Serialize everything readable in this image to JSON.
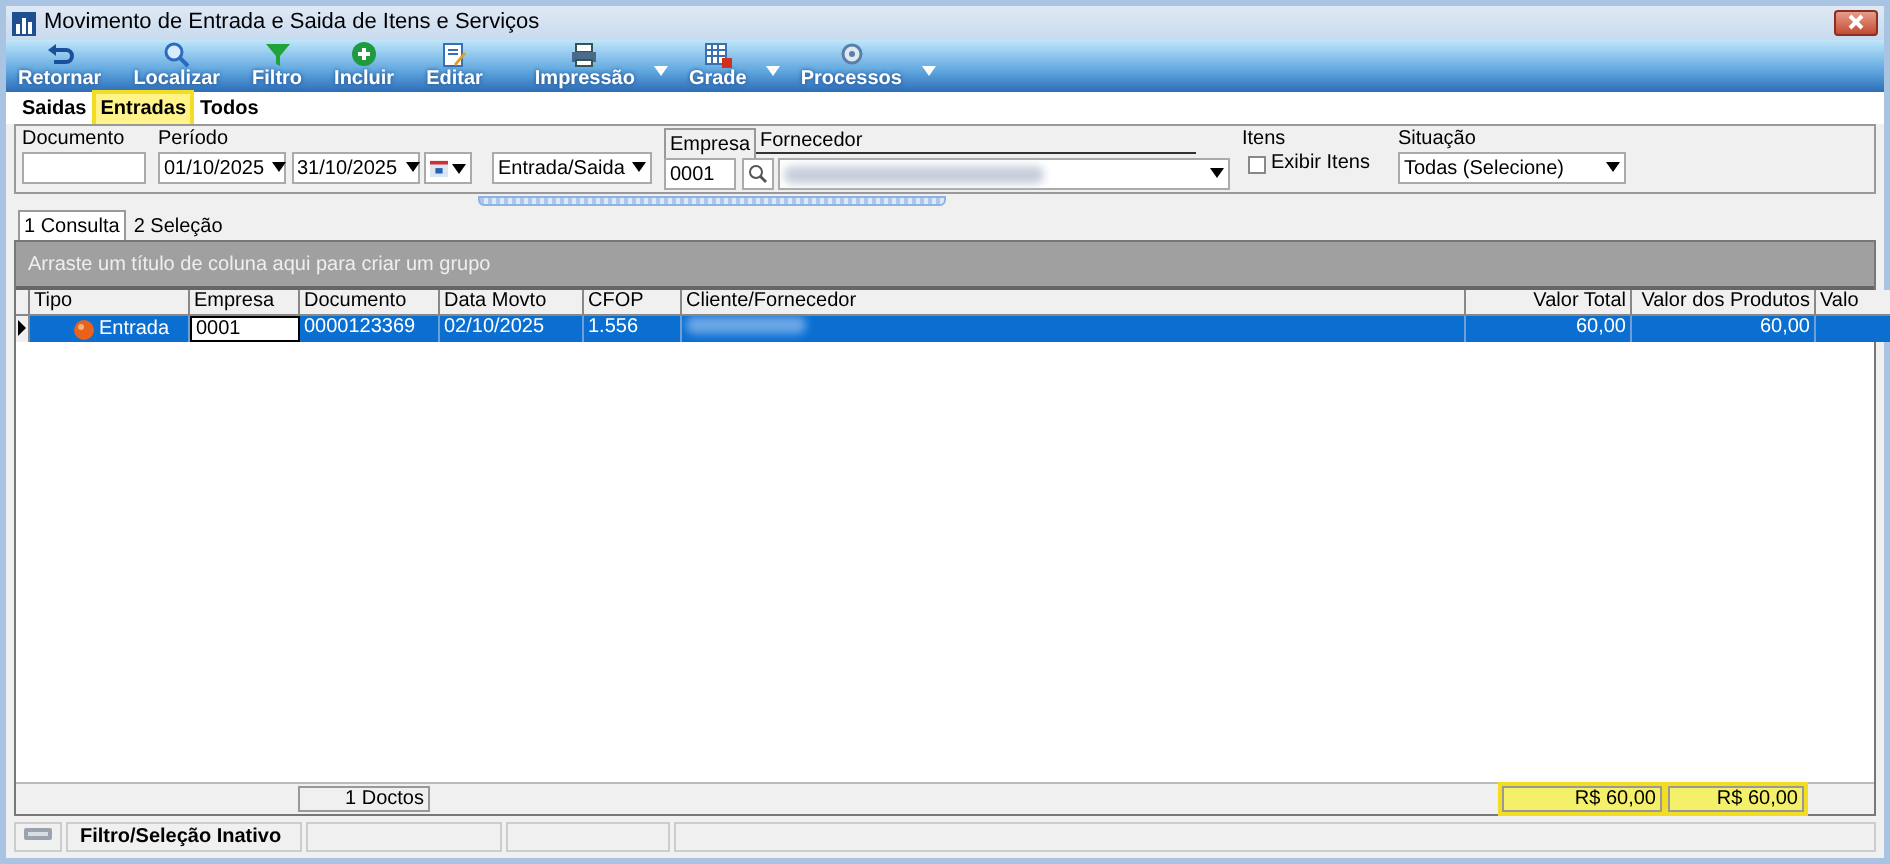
{
  "window": {
    "title": "Movimento de Entrada e Saida de Itens e Serviços"
  },
  "toolbar": [
    {
      "label": "Retornar",
      "dropdown": false
    },
    {
      "label": "Localizar",
      "dropdown": false
    },
    {
      "label": "Filtro",
      "dropdown": false
    },
    {
      "label": "Incluir",
      "dropdown": false
    },
    {
      "label": "Editar",
      "dropdown": false
    },
    {
      "label": "Impressão",
      "dropdown": true
    },
    {
      "label": "Grade",
      "dropdown": true
    },
    {
      "label": "Processos",
      "dropdown": true
    }
  ],
  "filter_tabs": [
    {
      "label": "Saidas",
      "selected": false
    },
    {
      "label": "Entradas",
      "selected": true
    },
    {
      "label": "Todos",
      "selected": false
    }
  ],
  "filters": {
    "documento": {
      "label": "Documento"
    },
    "periodo": {
      "label": "Período",
      "from": "01/10/2025",
      "to": "31/10/2025"
    },
    "tipo": {
      "value": "Entrada/Saida"
    },
    "lookup_tabs": [
      {
        "label": "Empresa",
        "selected": true
      },
      {
        "label": "Fornecedor",
        "selected": false
      }
    ],
    "empresa_code": "0001",
    "itens": {
      "label": "Itens",
      "checkbox": "Exibir Itens",
      "checked": false
    },
    "situacao": {
      "label": "Situação",
      "value": "Todas (Selecione)"
    }
  },
  "view_tabs": [
    {
      "label": "1 Consulta",
      "selected": true
    },
    {
      "label": "2 Seleção",
      "selected": false
    }
  ],
  "group_panel": "Arraste um título de coluna aqui para criar um grupo",
  "table": {
    "columns": [
      "Tipo",
      "Empresa",
      "Documento",
      "Data Movto",
      "CFOP",
      "Cliente/Fornecedor",
      "Valor Total",
      "Valor dos Produtos",
      "Valo"
    ],
    "rows": [
      {
        "tipo": "Entrada",
        "empresa": "0001",
        "documento": "0000123369",
        "data": "02/10/2025",
        "cfop": "1.556",
        "valor_total": "60,00",
        "valor_produtos": "60,00",
        "selected": true
      }
    ]
  },
  "footer": {
    "count": "1 Doctos",
    "totals": [
      {
        "value": "R$ 60,00",
        "highlighted": true
      },
      {
        "value": "R$ 60,00",
        "highlighted": true
      }
    ]
  },
  "status_bar": {
    "filter": "Filtro/Seleção Inativo"
  }
}
